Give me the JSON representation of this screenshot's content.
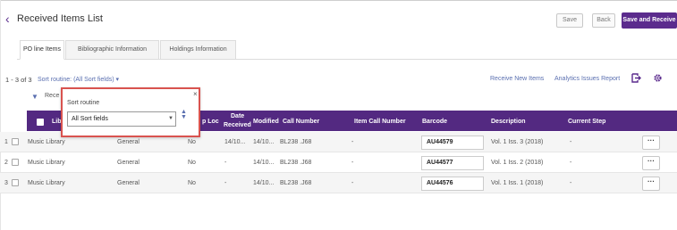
{
  "header": {
    "back_icon": "chevron-left-icon",
    "title": "Received Items List",
    "save_label": "Save",
    "back_label": "Back",
    "save_receive_label": "Save and Receive"
  },
  "tabs": [
    {
      "label": "PO line Items"
    },
    {
      "label": "Bibliographic Information"
    },
    {
      "label": "Holdings Information"
    }
  ],
  "toolbar": {
    "count": "1 - 3 of 3",
    "sort_label": "Sort routine: (All Sort fields) ▾",
    "receive_new": "Receive New Items",
    "analytics": "Analytics Issues Report",
    "export_icon": "export-icon",
    "settings_icon": "gear-icon"
  },
  "filter": {
    "icon": "filter-icon",
    "label": "Rece"
  },
  "popup": {
    "label": "Sort routine",
    "value": "All Sort fields",
    "close": "×"
  },
  "columns": {
    "library": "Lib",
    "loc": "p Loc",
    "date_received_1": "Date",
    "date_received_2": "Received",
    "modified": "Modified",
    "call_number": "Call Number",
    "item_call_number": "Item Call Number",
    "barcode": "Barcode",
    "description": "Description",
    "current_step": "Current Step"
  },
  "rows": [
    {
      "num": "1",
      "library": "Music Library",
      "location": "General",
      "loc": "No",
      "received": "14/10...",
      "modified": "14/10...",
      "call_number": "BL238 .J68",
      "item_call_number": "-",
      "barcode": "AU44579",
      "description": "Vol. 1 Iss. 3 (2018)",
      "current_step": "-"
    },
    {
      "num": "2",
      "library": "Music Library",
      "location": "General",
      "loc": "No",
      "received": "-",
      "modified": "14/10...",
      "call_number": "BL238 .J68",
      "item_call_number": "-",
      "barcode": "AU44577",
      "description": "Vol. 1 Iss. 2 (2018)",
      "current_step": "-"
    },
    {
      "num": "3",
      "library": "Music Library",
      "location": "General",
      "loc": "No",
      "received": "-",
      "modified": "14/10...",
      "call_number": "BL238 .J68",
      "item_call_number": "-",
      "barcode": "AU44576",
      "description": "Vol. 1 Iss. 1 (2018)",
      "current_step": "-"
    }
  ],
  "more_label": "···",
  "colors": {
    "accent": "#532981",
    "highlight": "#d9534f",
    "link": "#5a6fb0"
  }
}
